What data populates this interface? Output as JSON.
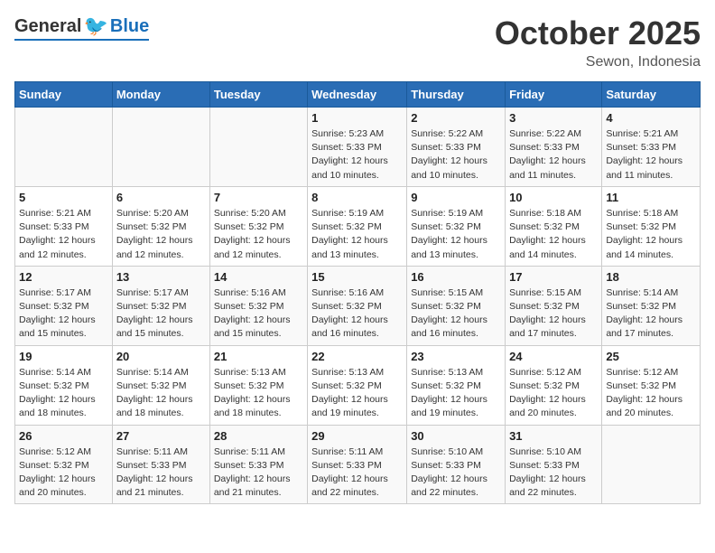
{
  "header": {
    "logo": {
      "general": "General",
      "blue": "Blue"
    },
    "month": "October 2025",
    "location": "Sewon, Indonesia"
  },
  "weekdays": [
    "Sunday",
    "Monday",
    "Tuesday",
    "Wednesday",
    "Thursday",
    "Friday",
    "Saturday"
  ],
  "weeks": [
    [
      {
        "day": "",
        "info": ""
      },
      {
        "day": "",
        "info": ""
      },
      {
        "day": "",
        "info": ""
      },
      {
        "day": "1",
        "info": "Sunrise: 5:23 AM\nSunset: 5:33 PM\nDaylight: 12 hours\nand 10 minutes."
      },
      {
        "day": "2",
        "info": "Sunrise: 5:22 AM\nSunset: 5:33 PM\nDaylight: 12 hours\nand 10 minutes."
      },
      {
        "day": "3",
        "info": "Sunrise: 5:22 AM\nSunset: 5:33 PM\nDaylight: 12 hours\nand 11 minutes."
      },
      {
        "day": "4",
        "info": "Sunrise: 5:21 AM\nSunset: 5:33 PM\nDaylight: 12 hours\nand 11 minutes."
      }
    ],
    [
      {
        "day": "5",
        "info": "Sunrise: 5:21 AM\nSunset: 5:33 PM\nDaylight: 12 hours\nand 12 minutes."
      },
      {
        "day": "6",
        "info": "Sunrise: 5:20 AM\nSunset: 5:32 PM\nDaylight: 12 hours\nand 12 minutes."
      },
      {
        "day": "7",
        "info": "Sunrise: 5:20 AM\nSunset: 5:32 PM\nDaylight: 12 hours\nand 12 minutes."
      },
      {
        "day": "8",
        "info": "Sunrise: 5:19 AM\nSunset: 5:32 PM\nDaylight: 12 hours\nand 13 minutes."
      },
      {
        "day": "9",
        "info": "Sunrise: 5:19 AM\nSunset: 5:32 PM\nDaylight: 12 hours\nand 13 minutes."
      },
      {
        "day": "10",
        "info": "Sunrise: 5:18 AM\nSunset: 5:32 PM\nDaylight: 12 hours\nand 14 minutes."
      },
      {
        "day": "11",
        "info": "Sunrise: 5:18 AM\nSunset: 5:32 PM\nDaylight: 12 hours\nand 14 minutes."
      }
    ],
    [
      {
        "day": "12",
        "info": "Sunrise: 5:17 AM\nSunset: 5:32 PM\nDaylight: 12 hours\nand 15 minutes."
      },
      {
        "day": "13",
        "info": "Sunrise: 5:17 AM\nSunset: 5:32 PM\nDaylight: 12 hours\nand 15 minutes."
      },
      {
        "day": "14",
        "info": "Sunrise: 5:16 AM\nSunset: 5:32 PM\nDaylight: 12 hours\nand 15 minutes."
      },
      {
        "day": "15",
        "info": "Sunrise: 5:16 AM\nSunset: 5:32 PM\nDaylight: 12 hours\nand 16 minutes."
      },
      {
        "day": "16",
        "info": "Sunrise: 5:15 AM\nSunset: 5:32 PM\nDaylight: 12 hours\nand 16 minutes."
      },
      {
        "day": "17",
        "info": "Sunrise: 5:15 AM\nSunset: 5:32 PM\nDaylight: 12 hours\nand 17 minutes."
      },
      {
        "day": "18",
        "info": "Sunrise: 5:14 AM\nSunset: 5:32 PM\nDaylight: 12 hours\nand 17 minutes."
      }
    ],
    [
      {
        "day": "19",
        "info": "Sunrise: 5:14 AM\nSunset: 5:32 PM\nDaylight: 12 hours\nand 18 minutes."
      },
      {
        "day": "20",
        "info": "Sunrise: 5:14 AM\nSunset: 5:32 PM\nDaylight: 12 hours\nand 18 minutes."
      },
      {
        "day": "21",
        "info": "Sunrise: 5:13 AM\nSunset: 5:32 PM\nDaylight: 12 hours\nand 18 minutes."
      },
      {
        "day": "22",
        "info": "Sunrise: 5:13 AM\nSunset: 5:32 PM\nDaylight: 12 hours\nand 19 minutes."
      },
      {
        "day": "23",
        "info": "Sunrise: 5:13 AM\nSunset: 5:32 PM\nDaylight: 12 hours\nand 19 minutes."
      },
      {
        "day": "24",
        "info": "Sunrise: 5:12 AM\nSunset: 5:32 PM\nDaylight: 12 hours\nand 20 minutes."
      },
      {
        "day": "25",
        "info": "Sunrise: 5:12 AM\nSunset: 5:32 PM\nDaylight: 12 hours\nand 20 minutes."
      }
    ],
    [
      {
        "day": "26",
        "info": "Sunrise: 5:12 AM\nSunset: 5:32 PM\nDaylight: 12 hours\nand 20 minutes."
      },
      {
        "day": "27",
        "info": "Sunrise: 5:11 AM\nSunset: 5:33 PM\nDaylight: 12 hours\nand 21 minutes."
      },
      {
        "day": "28",
        "info": "Sunrise: 5:11 AM\nSunset: 5:33 PM\nDaylight: 12 hours\nand 21 minutes."
      },
      {
        "day": "29",
        "info": "Sunrise: 5:11 AM\nSunset: 5:33 PM\nDaylight: 12 hours\nand 22 minutes."
      },
      {
        "day": "30",
        "info": "Sunrise: 5:10 AM\nSunset: 5:33 PM\nDaylight: 12 hours\nand 22 minutes."
      },
      {
        "day": "31",
        "info": "Sunrise: 5:10 AM\nSunset: 5:33 PM\nDaylight: 12 hours\nand 22 minutes."
      },
      {
        "day": "",
        "info": ""
      }
    ]
  ]
}
